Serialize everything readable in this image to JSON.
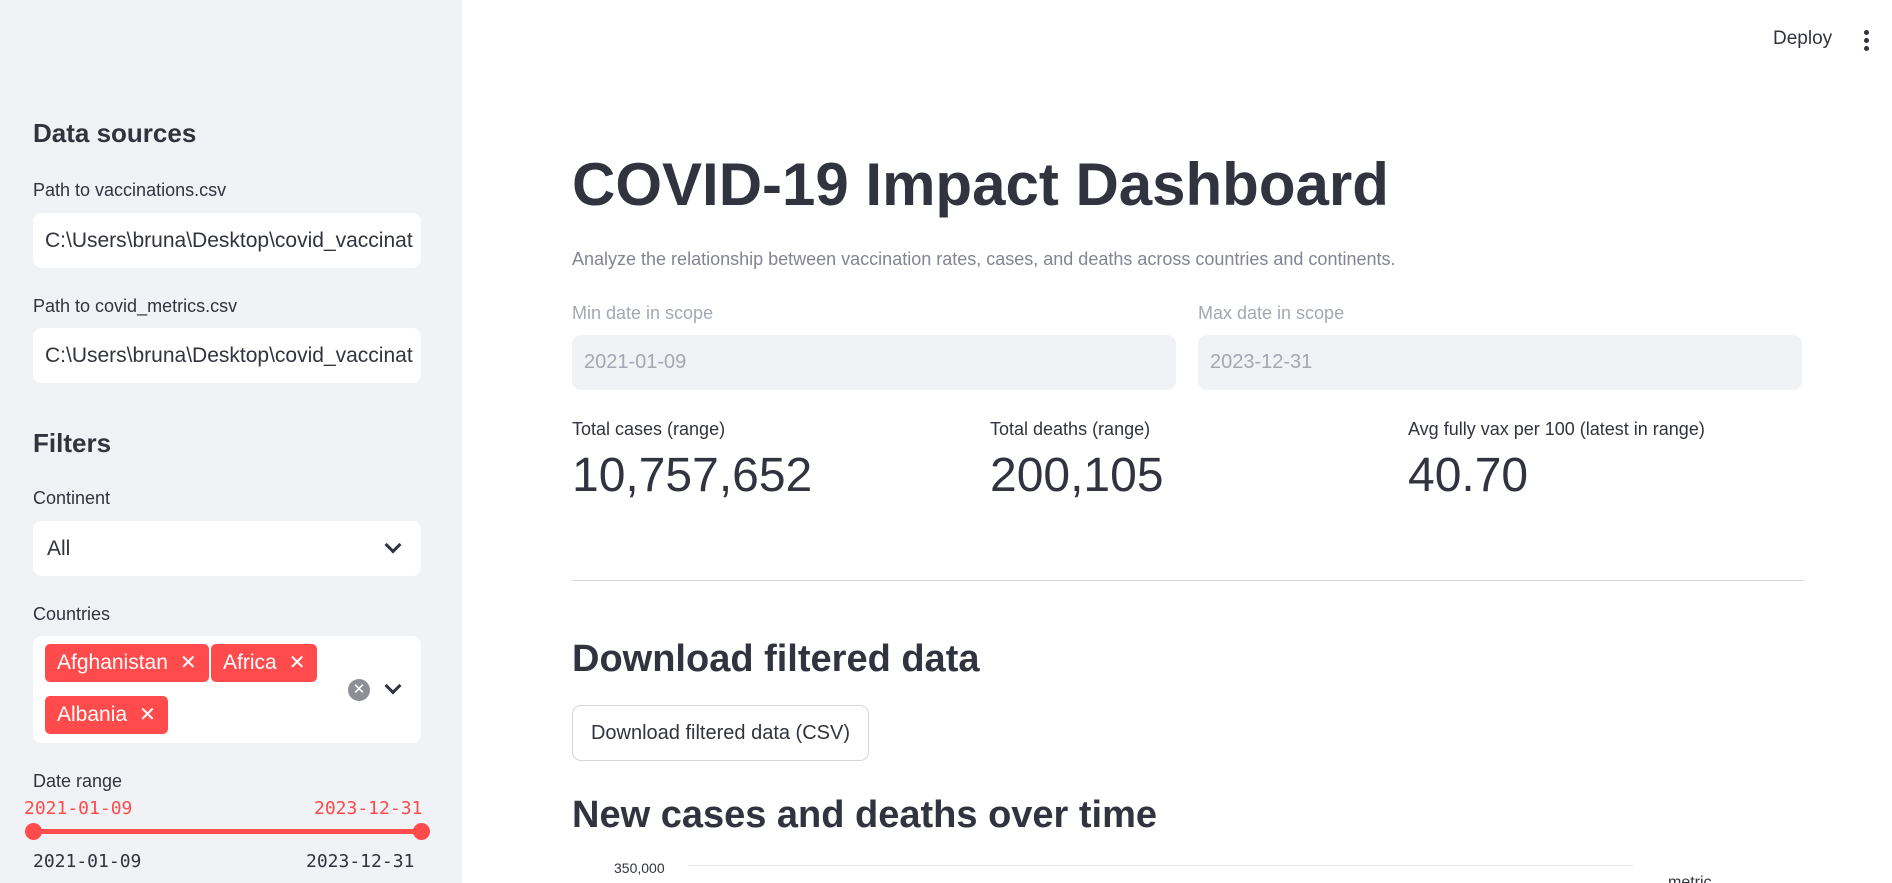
{
  "sidebar": {
    "data_sources_heading": "Data sources",
    "vacc_label": "Path to vaccinations.csv",
    "vacc_value": "C:\\Users\\bruna\\Desktop\\covid_vaccinat",
    "metrics_label": "Path to covid_metrics.csv",
    "metrics_value": "C:\\Users\\bruna\\Desktop\\covid_vaccinat",
    "filters_heading": "Filters",
    "continent_label": "Continent",
    "continent_value": "All",
    "countries_label": "Countries",
    "countries": [
      "Afghanistan",
      "Africa",
      "Albania"
    ],
    "date_range_label": "Date range",
    "range_start": "2021-01-09",
    "range_end": "2023-12-31",
    "range_min": "2021-01-09",
    "range_max": "2023-12-31"
  },
  "topbar": {
    "deploy_label": "Deploy"
  },
  "main": {
    "title": "COVID-19 Impact Dashboard",
    "caption": "Analyze the relationship between vaccination rates, cases, and deaths across countries and continents.",
    "min_date_label": "Min date in scope",
    "min_date_value": "2021-01-09",
    "max_date_label": "Max date in scope",
    "max_date_value": "2023-12-31",
    "metrics": [
      {
        "label": "Total cases (range)",
        "value": "10,757,652"
      },
      {
        "label": "Total deaths (range)",
        "value": "200,105"
      },
      {
        "label": "Avg fully vax per 100 (latest in range)",
        "value": "40.70"
      }
    ],
    "download_heading": "Download filtered data",
    "download_button": "Download filtered data (CSV)",
    "chart_heading": "New cases and deaths over time"
  },
  "chart_data": {
    "type": "line",
    "title": "",
    "y_ticks": [
      "350,000"
    ],
    "legend_title": "metric"
  },
  "colors": {
    "accent": "#ff4b4b",
    "sidebar_bg": "#f0f2f6",
    "text": "#31333f"
  }
}
